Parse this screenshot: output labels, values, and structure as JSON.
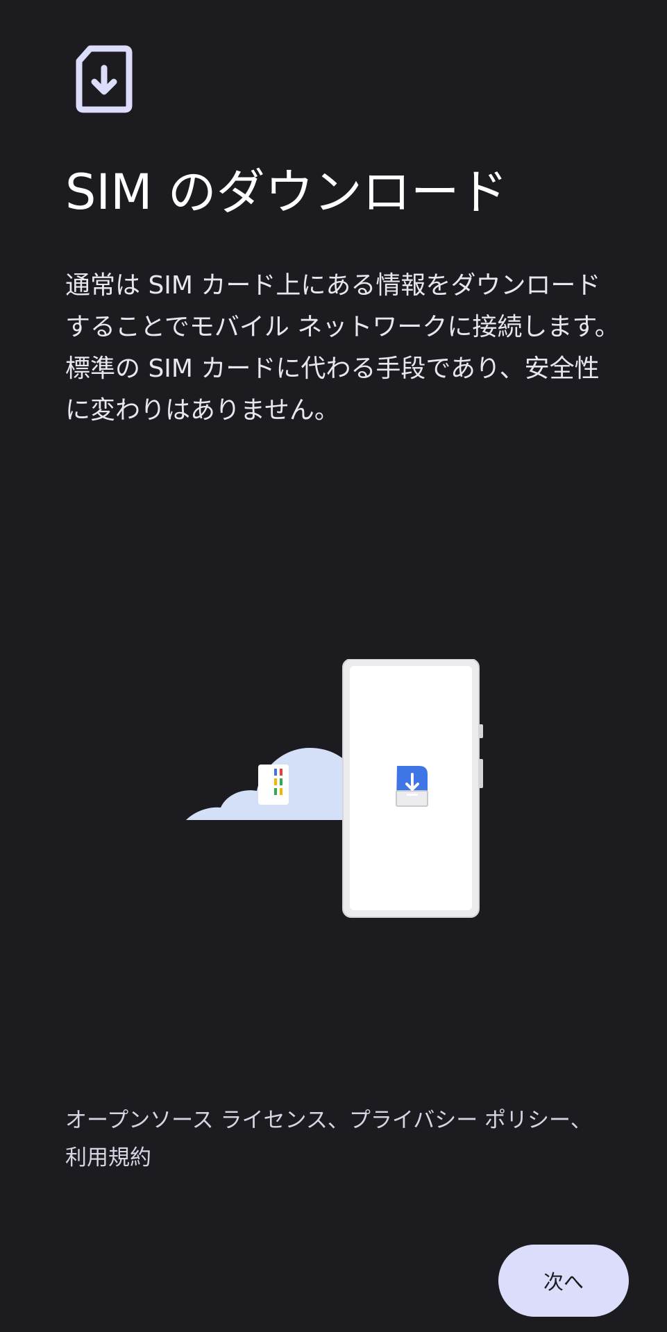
{
  "header": {
    "icon": "sim-download-icon",
    "title": "SIM のダウンロード"
  },
  "main": {
    "description": "通常は SIM カード上にある情報をダウンロードすることでモバイル ネットワークに接続します。標準の SIM カードに代わる手段であり、安全性に変わりはありません。",
    "illustration": {
      "cloud_icon": "cloud-with-sim-icon",
      "phone_icon": "phone-with-esim-icon"
    }
  },
  "footer": {
    "link_open_source": "オープンソース ライセンス",
    "sep1": "、",
    "link_privacy": "プライバシー ポリシー",
    "sep2": "、",
    "link_terms": "利用規約",
    "next_label": "次へ"
  },
  "colors": {
    "background": "#1c1b20",
    "icon_lavender": "#dcdcfb",
    "cloud": "#d3e0f7",
    "sim_blue": "#3f76e5",
    "button_bg": "#dcdcfb"
  }
}
